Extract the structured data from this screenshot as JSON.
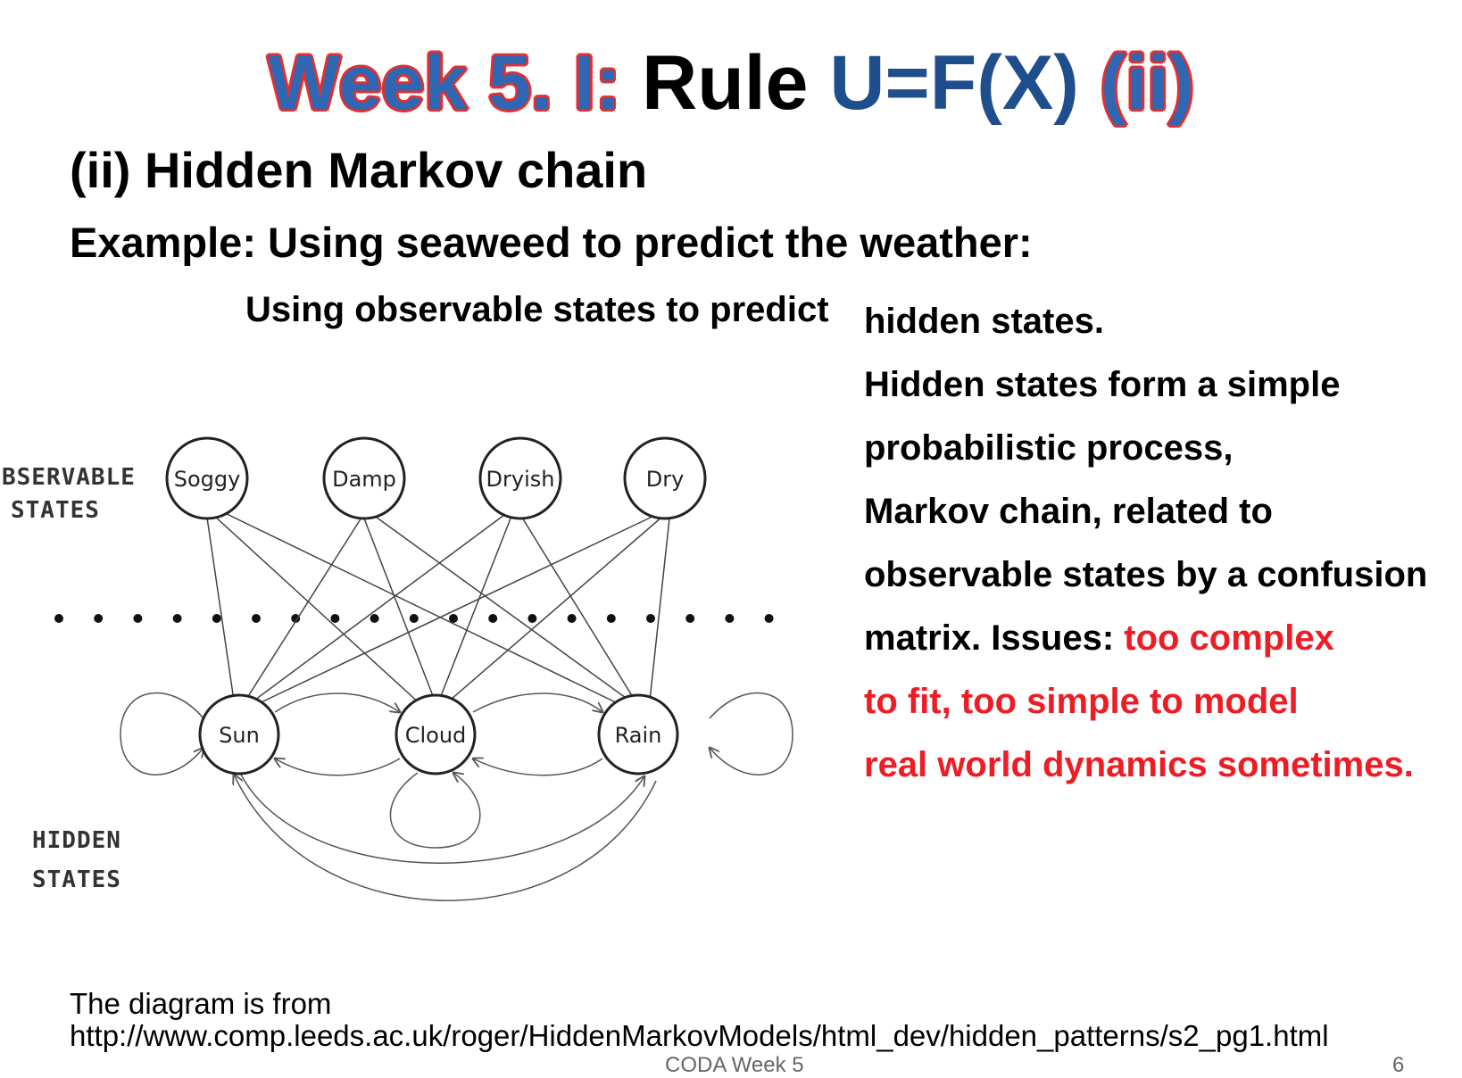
{
  "title": {
    "part1": "Week 5. I:",
    "part2": "Rule",
    "part3": "U=F(X)",
    "part4": "(ii)"
  },
  "subtitle": "(ii) Hidden Markov chain",
  "example": "Example: Using seaweed to predict the weather:",
  "observable_line": "Using observable states  to predict",
  "description": {
    "lines": [
      "hidden states.",
      "Hidden states form a simple",
      "probabilistic process,",
      "Markov chain, related to",
      "observable states by a confusion"
    ],
    "issues_prefix": "matrix. Issues: ",
    "issues_red": [
      "too complex",
      "to fit, too simple to model",
      "real world dynamics sometimes."
    ]
  },
  "diagram": {
    "observable_label": [
      "BSERVABLE",
      "STATES"
    ],
    "hidden_label": [
      "HIDDEN",
      "STATES"
    ],
    "observable_states": [
      "Soggy",
      "Damp",
      "Dryish",
      "Dry"
    ],
    "hidden_states": [
      "Sun",
      "Cloud",
      "Rain"
    ]
  },
  "source": {
    "label": "The diagram is from",
    "url": "http://www.comp.leeds.ac.uk/roger/HiddenMarkovModels/html_dev/hidden_patterns/s2_pg1.html"
  },
  "footer": "CODA Week 5",
  "page_number": "6"
}
